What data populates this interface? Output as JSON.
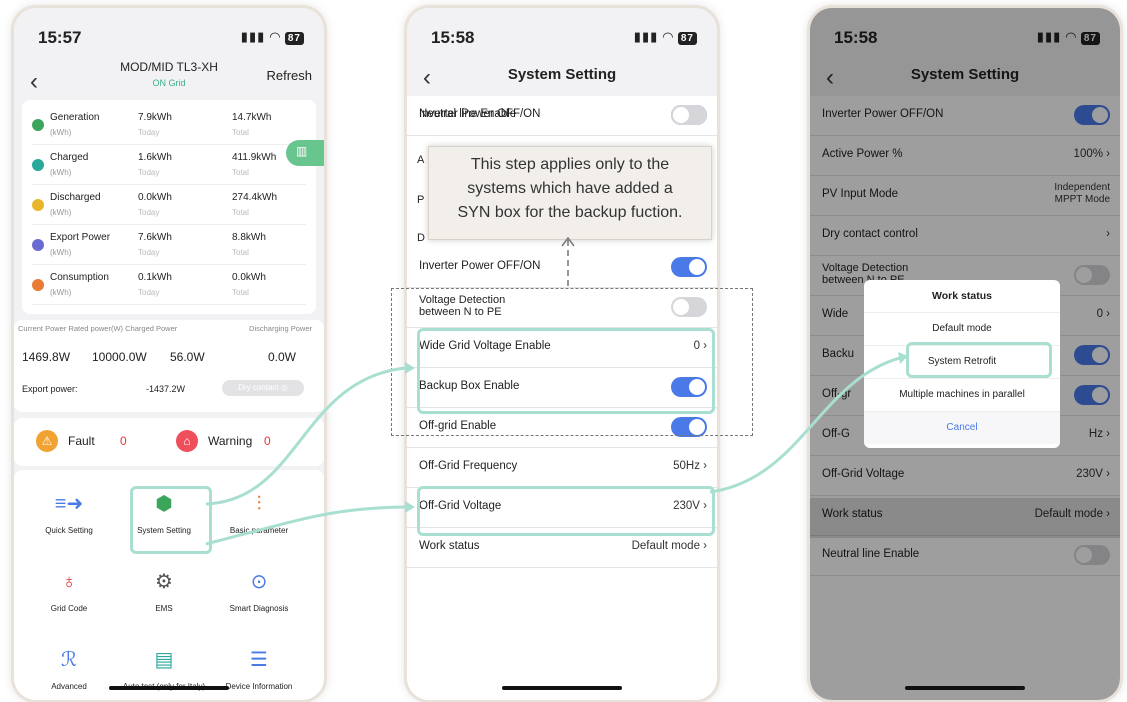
{
  "colors": {
    "accent": "#4a79e8",
    "teal": "#a8dfd1",
    "online": "#3bb08a"
  },
  "phone1": {
    "time": "15:57",
    "battery": "87",
    "title": "MOD/MID TL3-XH",
    "subtitle": "ON Grid",
    "refresh": "Refresh",
    "metrics": [
      {
        "name": "Generation",
        "unit": "(kWh)",
        "today": "7.9kWh",
        "today_label": "Today",
        "total": "14.7kWh",
        "total_label": "Total",
        "color": "#3ba55c"
      },
      {
        "name": "Charged",
        "unit": "(kWh)",
        "today": "1.6kWh",
        "today_label": "Today",
        "total": "411.9kWh",
        "total_label": "Total",
        "color": "#2aa89a"
      },
      {
        "name": "Discharged",
        "unit": "(kWh)",
        "today": "0.0kWh",
        "today_label": "Today",
        "total": "274.4kWh",
        "total_label": "Total",
        "color": "#e8b62a"
      },
      {
        "name": "Export Power",
        "unit": "(kWh)",
        "today": "7.6kWh",
        "today_label": "Today",
        "total": "8.8kWh",
        "total_label": "Total",
        "color": "#6a6bd0"
      },
      {
        "name": "Consumption",
        "unit": "(kWh)",
        "today": "0.1kWh",
        "today_label": "Today",
        "total": "0.0kWh",
        "total_label": "Total",
        "color": "#e97c34"
      }
    ],
    "power_headers": [
      "Current Power",
      "Rated power(W)",
      "Charged Power",
      "Discharging Power"
    ],
    "power_values": [
      "1469.8W",
      "10000.0W",
      "56.0W",
      "0.0W"
    ],
    "export_label": "Export power:",
    "export_value": "-1437.2W",
    "dry_contact": "Dry contact",
    "fault_label": "Fault",
    "fault_count": "0",
    "warning_label": "Warning",
    "warning_count": "0",
    "buttons": [
      {
        "label": "Quick Setting",
        "icon": "quick-setting-icon"
      },
      {
        "label": "System Setting",
        "icon": "system-setting-icon"
      },
      {
        "label": "Basic parameter",
        "icon": "basic-parameter-icon"
      },
      {
        "label": "Grid Code",
        "icon": "grid-code-icon"
      },
      {
        "label": "EMS",
        "icon": "ems-icon"
      },
      {
        "label": "Smart Diagnosis",
        "icon": "smart-diagnosis-icon"
      },
      {
        "label": "Advanced",
        "icon": "advanced-icon"
      },
      {
        "label": "Auto test (only for Italy)",
        "icon": "auto-test-icon"
      },
      {
        "label": "Device Information",
        "icon": "device-info-icon"
      }
    ]
  },
  "phone2": {
    "time": "15:58",
    "battery": "87",
    "title": "System Setting",
    "rows": [
      {
        "label": "Inverter Power OFF/ON",
        "type": "toggle",
        "on": true
      },
      {
        "label": "Voltage Detection between N to PE",
        "type": "toggle",
        "on": false
      },
      {
        "label": "Wide Grid Voltage Enable",
        "type": "value",
        "value": "0"
      },
      {
        "label": "Backup Box Enable",
        "type": "toggle",
        "on": true
      },
      {
        "label": "Off-grid Enable",
        "type": "toggle",
        "on": true
      },
      {
        "label": "Off-Grid Frequency",
        "type": "value",
        "value": "50Hz"
      },
      {
        "label": "Off-Grid Voltage",
        "type": "value",
        "value": "230V"
      },
      {
        "label": "Work status",
        "type": "value",
        "value": "Default mode"
      },
      {
        "label": "Neutral line Enable",
        "type": "toggle",
        "on": false
      }
    ],
    "hidden_initials": [
      "A",
      "P",
      "D"
    ]
  },
  "callout": {
    "lines": [
      "This step applies only to the",
      "systems which have added a",
      "SYN box for the backup fuction."
    ]
  },
  "phone3": {
    "time": "15:58",
    "battery": "87",
    "title": "System Setting",
    "rows": [
      {
        "label": "Inverter Power OFF/ON",
        "type": "toggle",
        "on": true
      },
      {
        "label": "Active Power %",
        "type": "value",
        "value": "100%"
      },
      {
        "label": "PV Input Mode",
        "type": "value2",
        "value": "Independent MPPT Mode"
      },
      {
        "label": "Dry contact control",
        "type": "chevron"
      },
      {
        "label": "Voltage Detection between N to PE",
        "type": "toggle",
        "on": false
      },
      {
        "label": "Wide",
        "type": "value",
        "value": "0"
      },
      {
        "label": "Backu",
        "type": "toggle",
        "on": true
      },
      {
        "label": "Off-gr",
        "type": "toggle",
        "on": true
      },
      {
        "label": "Off-G",
        "type": "value",
        "value": "Hz"
      },
      {
        "label": "Off-Grid Voltage",
        "type": "value",
        "value": "230V"
      },
      {
        "label": "Work status",
        "type": "value",
        "value": "Default mode"
      },
      {
        "label": "Neutral line Enable",
        "type": "toggle",
        "on": false
      }
    ],
    "dialog": {
      "title": "Work status",
      "options": [
        "Default mode",
        "System Retrofit",
        "Multiple machines in parallel"
      ],
      "cancel": "Cancel"
    }
  }
}
